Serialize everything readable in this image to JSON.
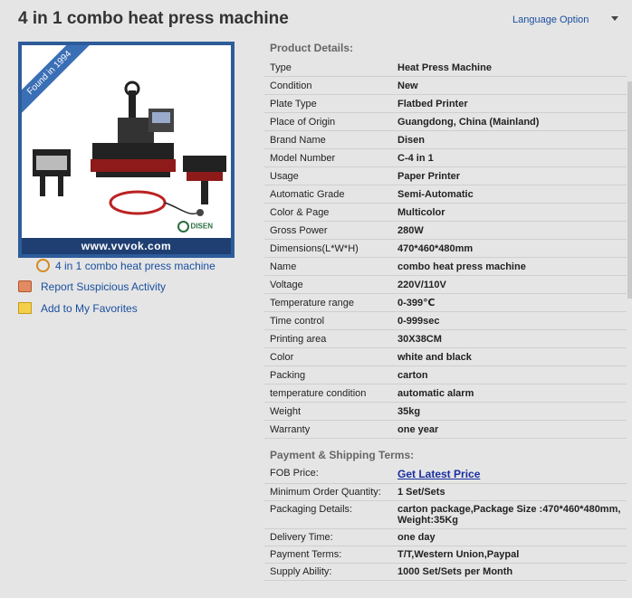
{
  "title": "4 in 1 combo heat press machine",
  "language_option": "Language Option",
  "image": {
    "ribbon": "Found in 1994",
    "footer": "www.vvvok.com",
    "logo": "DISEN"
  },
  "caption": "4 in 1 combo heat press machine",
  "sidebar": {
    "report": "Report Suspicious Activity",
    "favorites": "Add to My Favorites"
  },
  "product_details_title": "Product Details:",
  "product_details": [
    {
      "k": "Type",
      "v": "Heat Press Machine"
    },
    {
      "k": "Condition",
      "v": "New"
    },
    {
      "k": "Plate Type",
      "v": "Flatbed Printer"
    },
    {
      "k": "Place of Origin",
      "v": "Guangdong, China (Mainland)"
    },
    {
      "k": "Brand Name",
      "v": "Disen"
    },
    {
      "k": "Model Number",
      "v": "C-4 in 1"
    },
    {
      "k": "Usage",
      "v": "Paper Printer"
    },
    {
      "k": "Automatic Grade",
      "v": "Semi-Automatic"
    },
    {
      "k": "Color & Page",
      "v": "Multicolor"
    },
    {
      "k": "Gross Power",
      "v": "280W"
    },
    {
      "k": "Dimensions(L*W*H)",
      "v": "470*460*480mm"
    },
    {
      "k": "Name",
      "v": "combo heat press machine"
    },
    {
      "k": "Voltage",
      "v": "220V/110V"
    },
    {
      "k": "Temperature range",
      "v": "0-399℃"
    },
    {
      "k": "Time control",
      "v": "0-999sec"
    },
    {
      "k": "Printing area",
      "v": "30X38CM"
    },
    {
      "k": "Color",
      "v": "white and black"
    },
    {
      "k": "Packing",
      "v": "carton"
    },
    {
      "k": "temperature condition",
      "v": "automatic alarm"
    },
    {
      "k": "Weight",
      "v": "35kg"
    },
    {
      "k": "Warranty",
      "v": "one year"
    }
  ],
  "payment_title": "Payment & Shipping Terms:",
  "payment": {
    "fob_label": "FOB Price:",
    "fob_link": "Get Latest Price",
    "rows": [
      {
        "k": "Minimum Order Quantity:",
        "v": "1 Set/Sets"
      },
      {
        "k": "Packaging Details:",
        "v": "carton package,Package Size :470*460*480mm, Weight:35Kg"
      },
      {
        "k": "Delivery Time:",
        "v": "one day"
      },
      {
        "k": "Payment Terms:",
        "v": "T/T,Western Union,Paypal"
      },
      {
        "k": "Supply Ability:",
        "v": "1000 Set/Sets per Month"
      }
    ]
  }
}
